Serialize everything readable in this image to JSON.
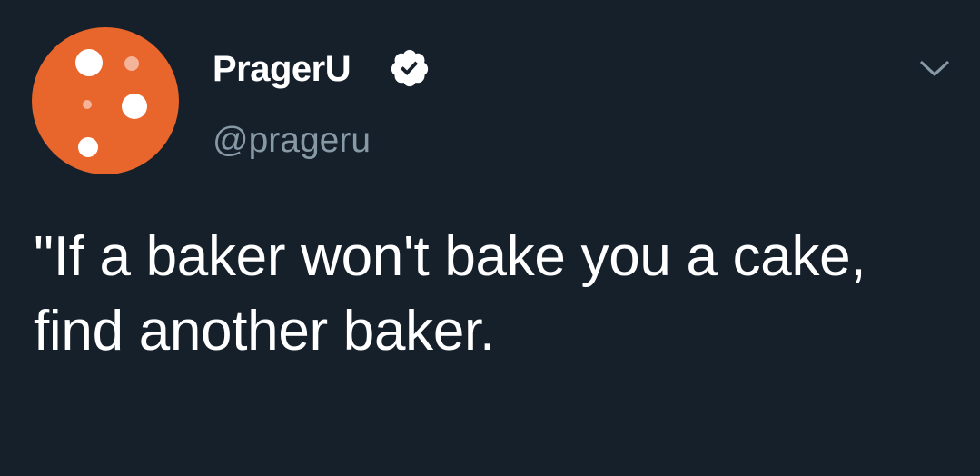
{
  "colors": {
    "background": "#15202b",
    "avatar_orange": "#e8652b",
    "text_primary": "#ffffff",
    "text_secondary": "#8899a6"
  },
  "author": {
    "display_name": "PragerU",
    "handle": "@prageru",
    "verified_icon": "verified-badge-icon"
  },
  "menu": {
    "icon": "chevron-down-icon"
  },
  "tweet": {
    "text": "\"If a baker won't bake you a cake, find another baker."
  }
}
